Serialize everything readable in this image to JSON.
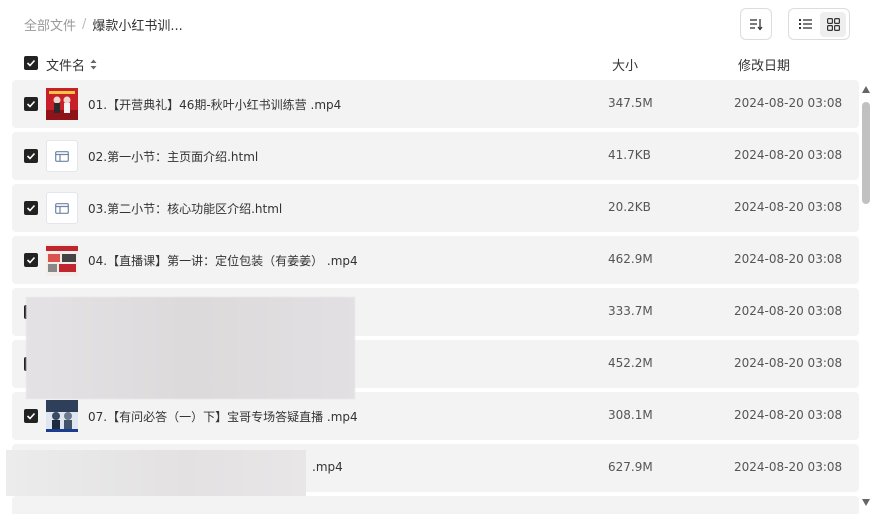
{
  "breadcrumb": {
    "root": "全部文件",
    "separator": "/",
    "current": "爆款小红书训..."
  },
  "toolbar": {
    "sort_icon": "sort-icon",
    "list_icon": "list-view-icon",
    "grid_icon": "grid-view-icon",
    "active_view": "list"
  },
  "header": {
    "name": "文件名",
    "size": "大小",
    "date": "修改日期"
  },
  "files": [
    {
      "name": "01.【开营典礼】46期-秋叶小红书训练营 .mp4",
      "size": "347.5M",
      "date": "2024-08-20 03:08",
      "type": "video",
      "checked": true
    },
    {
      "name": "02.第一小节：主页面介绍.html",
      "size": "41.7KB",
      "date": "2024-08-20 03:08",
      "type": "html",
      "checked": true
    },
    {
      "name": "03.第二小节：核心功能区介绍.html",
      "size": "20.2KB",
      "date": "2024-08-20 03:08",
      "type": "html",
      "checked": true
    },
    {
      "name": "04.【直播课】第一讲：定位包装（有姜姜） .mp4",
      "size": "462.9M",
      "date": "2024-08-20 03:08",
      "type": "video",
      "checked": true
    },
    {
      "name": "",
      "size": "333.7M",
      "date": "2024-08-20 03:08",
      "type": "video",
      "checked": true
    },
    {
      "name": "",
      "size": "452.2M",
      "date": "2024-08-20 03:08",
      "type": "video",
      "checked": true
    },
    {
      "name": "07.【有问必答（一）下】宝哥专场答疑直播 .mp4",
      "size": "308.1M",
      "date": "2024-08-20 03:08",
      "type": "video",
      "checked": true
    },
    {
      "name": ".mp4",
      "size": "627.9M",
      "date": "2024-08-20 03:08",
      "type": "video",
      "checked": true
    }
  ],
  "colors": {
    "row_bg": "#f3f3f3",
    "checkbox": "#222222",
    "text": "#333333",
    "muted": "#999999"
  }
}
